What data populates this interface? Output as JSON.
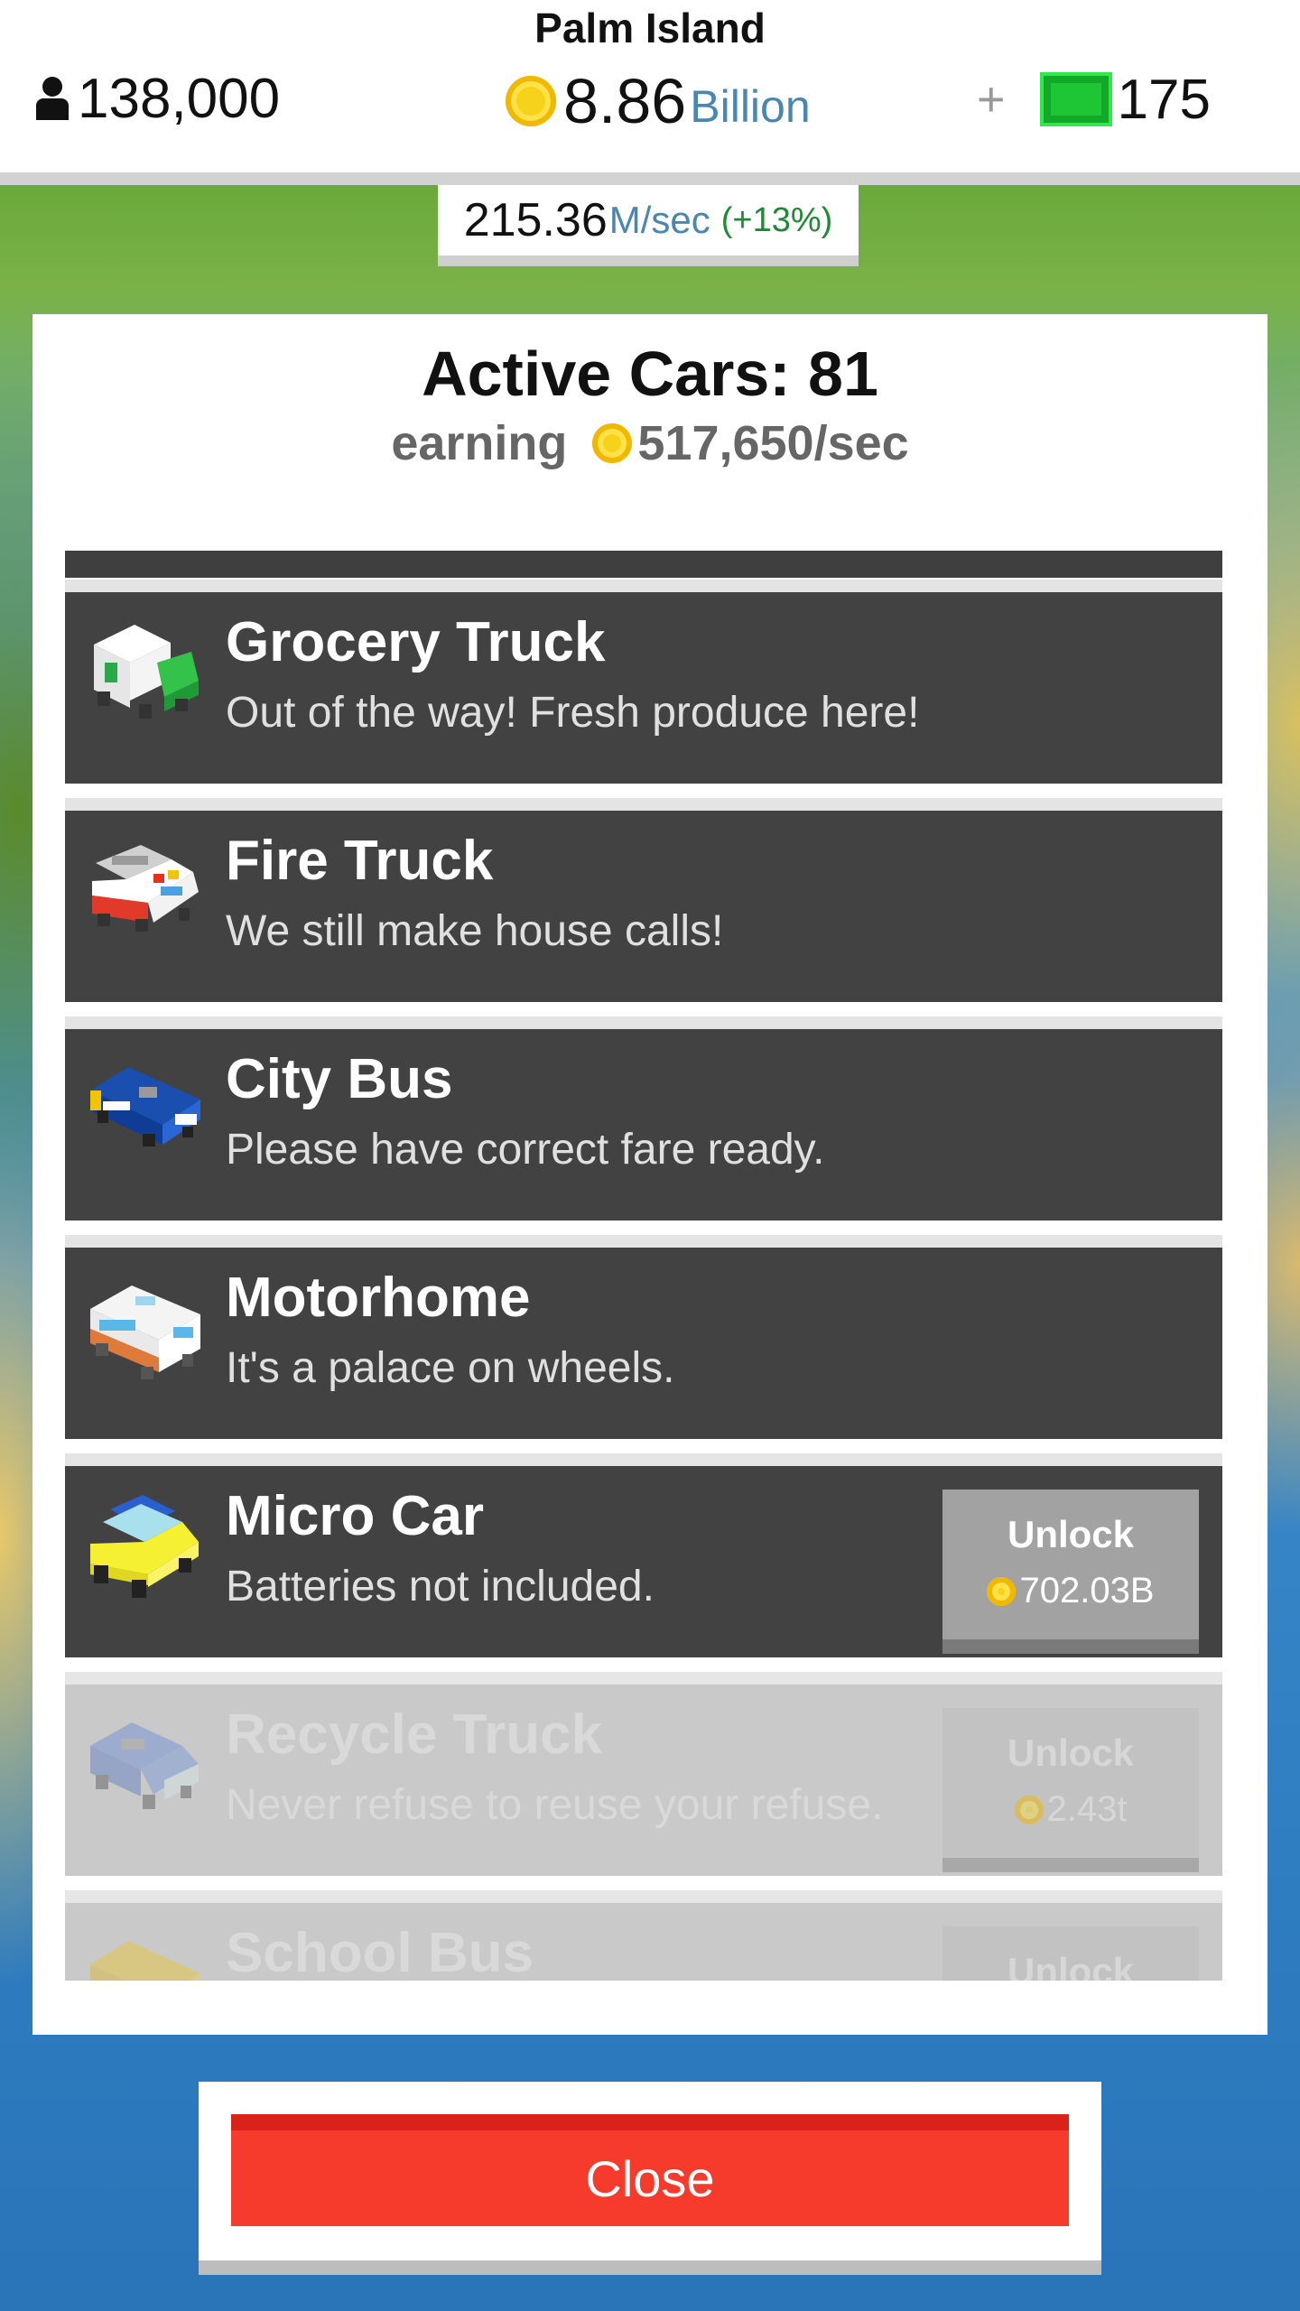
{
  "header": {
    "island_name": "Palm Island",
    "population": "138,000",
    "money_value": "8.86",
    "money_unit": "Billion",
    "cash_plus": "+",
    "cash_value": "175"
  },
  "rate": {
    "value": "215.36",
    "unit": "M/sec",
    "bonus": "(+13%)"
  },
  "panel": {
    "title": "Active Cars: 81",
    "earning_label": "earning",
    "earning_amount": "517,650/sec"
  },
  "vehicles": [
    {
      "name": "Grocery Truck",
      "desc": "Out of the way! Fresh produce here!",
      "icon": "grocery-truck-icon"
    },
    {
      "name": "Fire Truck",
      "desc": "We still make house calls!",
      "icon": "fire-truck-icon"
    },
    {
      "name": "City Bus",
      "desc": "Please have correct fare ready.",
      "icon": "city-bus-icon"
    },
    {
      "name": "Motorhome",
      "desc": "It's a palace on wheels.",
      "icon": "motorhome-icon"
    },
    {
      "name": "Micro Car",
      "desc": "Batteries not included.",
      "icon": "micro-car-icon",
      "unlock_label": "Unlock",
      "price": "702.03B"
    },
    {
      "name": "Recycle Truck",
      "desc": "Never refuse to reuse your refuse.",
      "icon": "recycle-truck-icon",
      "unlock_label": "Unlock",
      "price": "2.43t"
    },
    {
      "name": "School Bus",
      "desc": "",
      "icon": "school-bus-icon",
      "unlock_label": "Unlock",
      "price": ""
    }
  ],
  "close_label": "Close",
  "colors": {
    "close_button": "#f63a2c",
    "row_bg": "#424242",
    "locked_row_bg": "#c9c9c9",
    "cash_green": "#1ec636"
  }
}
